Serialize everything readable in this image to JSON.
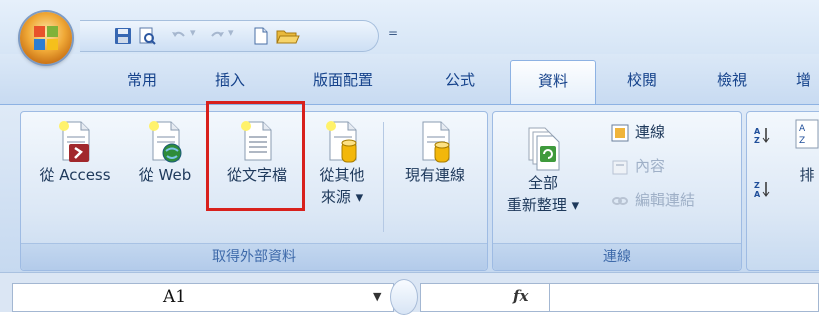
{
  "quick_access": {
    "icons": [
      "save-icon",
      "print-preview-icon",
      "undo-icon",
      "redo-icon",
      "new-document-icon",
      "open-folder-icon"
    ],
    "customize_glyph": "="
  },
  "tabs": [
    {
      "label": "常用",
      "active": false
    },
    {
      "label": "插入",
      "active": false
    },
    {
      "label": "版面配置",
      "active": false
    },
    {
      "label": "公式",
      "active": false
    },
    {
      "label": "資料",
      "active": true
    },
    {
      "label": "校閱",
      "active": false
    },
    {
      "label": "檢視",
      "active": false
    },
    {
      "label": "增",
      "active": false
    }
  ],
  "groups": {
    "external_data": {
      "label": "取得外部資料",
      "buttons": {
        "from_access": "從 Access",
        "from_web": "從 Web",
        "from_text": "從文字檔",
        "from_other_line1": "從其他",
        "from_other_line2": "來源 ▾",
        "existing_connections": "現有連線"
      }
    },
    "connections": {
      "label": "連線",
      "refresh_line1": "全部",
      "refresh_line2": "重新整理 ▾",
      "connections": "連線",
      "properties": "內容",
      "edit_links": "編輯連結"
    },
    "sort": {
      "sort_az": "A↓Z",
      "sort_za": "Z↓A",
      "sort_partial": "排"
    }
  },
  "formula_bar": {
    "name_box_value": "A1",
    "fx_label": "fx"
  },
  "colors": {
    "highlight": "#d8201c",
    "ribbon_text": "#1e395b",
    "tab_text": "#15428b"
  }
}
